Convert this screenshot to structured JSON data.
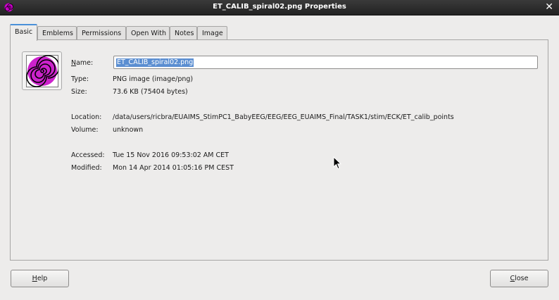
{
  "window": {
    "title": "ET_CALIB_spiral02.png Properties",
    "close_glyph": "✕"
  },
  "tabs": [
    {
      "label": "Basic",
      "active": true
    },
    {
      "label": "Emblems"
    },
    {
      "label": "Permissions"
    },
    {
      "label": "Open With"
    },
    {
      "label": "Notes"
    },
    {
      "label": "Image"
    }
  ],
  "basic": {
    "file_icon": "spiral-image-icon",
    "name_label": "Name:",
    "name_value": "ET_CALIB_spiral02.png",
    "type_label": "Type:",
    "type_value": "PNG image (image/png)",
    "size_label": "Size:",
    "size_value": "73.6 KB (75404 bytes)",
    "location_label": "Location:",
    "location_value": "/data/users/ricbra/EUAIMS_StimPC1_BabyEEG/EEG/EEG_EUAIMS_Final/TASK1/stim/ECK/ET_calib_points",
    "volume_label": "Volume:",
    "volume_value": "unknown",
    "accessed_label": "Accessed:",
    "accessed_value": "Tue 15 Nov 2016 09:53:02 AM CET",
    "modified_label": "Modified:",
    "modified_value": "Mon 14 Apr 2014 01:05:16 PM CEST"
  },
  "buttons": {
    "help": "Help",
    "close": "Close"
  },
  "colors": {
    "accent": "#cc00cc",
    "selection": "#5b8ed1"
  }
}
